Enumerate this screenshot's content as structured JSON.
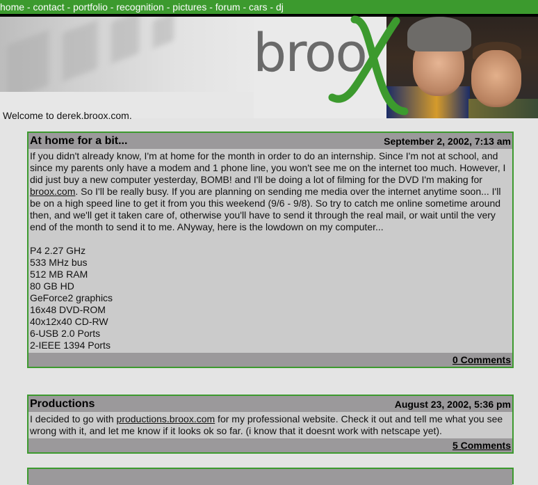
{
  "nav": {
    "items": [
      "home",
      "contact",
      "portfolio",
      "recognition",
      "pictures",
      "forum",
      "cars",
      "dj"
    ],
    "separator": " - "
  },
  "header": {
    "brand_text": "broo",
    "brand_x": "X",
    "welcome": "Welcome to derek.broox.com."
  },
  "posts": [
    {
      "title": "At home for a bit...",
      "date": "September 2, 2002, 7:13 am",
      "body_p1_a": "If you didn't already know, I'm at home for the month in order to do an internship. Since I'm not at school, and since my parents only have a modem and 1 phone line, you won't see me on the internet too much. However, I did just buy a new computer yesterday, BOMB! and I'll be doing a lot of filming for the DVD I'm making for ",
      "body_link": "broox.com",
      "body_p1_b": ". So I'll be really busy. If you are planning on sending me media over the internet anytime soon... I'll be on a high speed line to get it from you this weekend (9/6 - 9/8). So try to catch me online sometime around then, and we'll get it taken care of, otherwise you'll have to send it through the real mail, or wait until the very end of the month to send it to me. ANyway, here is the lowdown on my computer...",
      "specs": [
        "P4 2.27 GHz",
        "533 MHz bus",
        "512 MB RAM",
        "80 GB HD",
        "GeForce2 graphics",
        "16x48 DVD-ROM",
        "40x12x40 CD-RW",
        "6-USB 2.0 Ports",
        "2-IEEE 1394 Ports"
      ],
      "comments": "0 Comments"
    },
    {
      "title": "Productions",
      "date": "August 23, 2002, 5:36 pm",
      "body_a": "I decided to go with ",
      "body_link": "productions.broox.com",
      "body_b": " for my professional website. Check it out and tell me what you see wrong with it, and let me know if it looks ok so far. (i know that it doesnt work with netscape yet).",
      "comments": "5 Comments"
    }
  ],
  "colors": {
    "green": "#3c9a2e",
    "post_bg": "#cbcbcb",
    "post_bar": "#9b999b",
    "page_bg": "#e4e4e4"
  }
}
